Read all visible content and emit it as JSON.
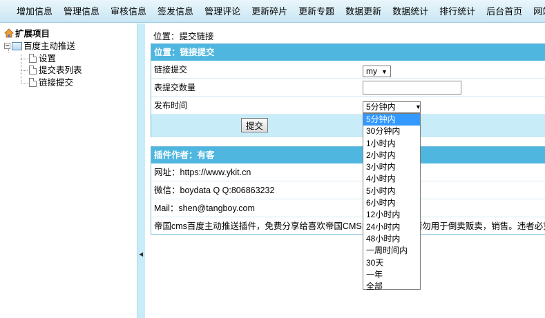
{
  "topnav": [
    "增加信息",
    "管理信息",
    "审核信息",
    "签发信息",
    "管理评论",
    "更新碎片",
    "更新专题",
    "数据更新",
    "数据统计",
    "排行统计",
    "后台首页",
    "网站首页"
  ],
  "tree": {
    "root": "扩展项目",
    "node": "百度主动推送",
    "leaves": [
      "设置",
      "提交表列表",
      "链接提交"
    ]
  },
  "breadcrumb": "位置：提交链接",
  "form": {
    "header": "位置：链接提交",
    "rows": [
      {
        "label": "链接提交",
        "select_value": "my"
      },
      {
        "label": "表提交数量",
        "input_value": ""
      },
      {
        "label": "发布时间",
        "select_value": "5分钟内"
      }
    ],
    "submit_label": "提交"
  },
  "author": {
    "header": "插件作者：有客",
    "lines": [
      "网址：https://www.ykit.cn",
      "微信：boydata  Q Q:806863232",
      "Mail：shen@tangboy.com",
      "帝国cms百度主动推送插件，免费分享给喜欢帝国CMS的朋友使用，请勿用于倒卖贩卖，销售。违者必究！"
    ]
  },
  "dropdown": {
    "options": [
      "5分钟内",
      "30分钟内",
      "1小时内",
      "2小时内",
      "3小时内",
      "4小时内",
      "5小时内",
      "6小时内",
      "12小时内",
      "24小时内",
      "48小时内",
      "一周时间内",
      "30天",
      "一年",
      "全部"
    ],
    "selected_index": 0
  },
  "colors": {
    "panel_header": "#4eb6df",
    "highlight": "#3399ff",
    "splitter": "#c8ecf8"
  }
}
